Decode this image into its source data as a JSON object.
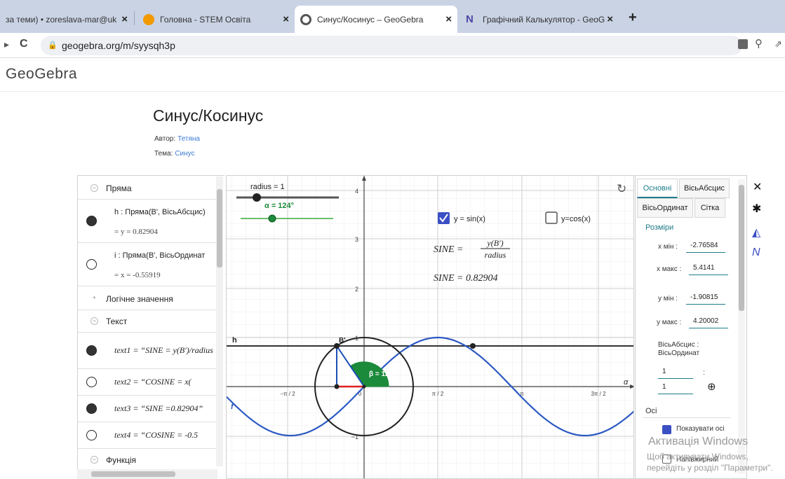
{
  "browser": {
    "tabs": [
      {
        "title": "за теми) • zoreslava-mar@uk",
        "icon_color": "#d93025"
      },
      {
        "title": "Головна - STEM Освіта",
        "icon_color": "#f29900"
      },
      {
        "title": "Синус/Косинус – GeoGebra",
        "icon_color": "#666666"
      },
      {
        "title": "Графічний Калькулятор - GeoG",
        "icon_color": "#5145a8"
      }
    ],
    "close_glyph": "×",
    "new_tab_glyph": "+",
    "url": "geogebra.org/m/syysqh3p",
    "reload_glyph": "C",
    "lock_glyph": "🔒"
  },
  "site": {
    "logo": "GeoGebra"
  },
  "page": {
    "title": "Синус/Косинус",
    "author_label": "Автор:",
    "author": "Тетяна",
    "topic_label": "Тема:",
    "topic": "Синус"
  },
  "algebra": {
    "groups": {
      "line": "Пряма",
      "bool": "Логічне значення",
      "text": "Текст",
      "func": "Функція"
    },
    "h_def": "h : Пряма(B', ВісьАбсцис)",
    "h_val": "= y = 0.82904",
    "i_def": "i : Пряма(B', ВісьОрдинат",
    "i_val": "= x = -0.55919",
    "text1": "text1 = “SINE = y(B')/radius",
    "text2": "text2 = “COSINE = x(",
    "text3": "text3 = “SINE =0.82904”",
    "text4": "text4 = “COSINE = -0.5"
  },
  "graphics": {
    "slider_radius": "radius = 1",
    "slider_alpha": "α = 124°",
    "chk_sin": "y = sin(x)",
    "chk_cos": "y=cos(x)",
    "sine_formula_lhs": "SINE =",
    "sine_formula_num": "y(B')",
    "sine_formula_den": "radius",
    "sine_value": "SINE = 0.82904",
    "point_b": "B'",
    "line_h": "h",
    "angle_label": "β = 124°",
    "axis_x_label": "α",
    "ticks_y": [
      "4",
      "3",
      "2",
      "1"
    ],
    "ticks_x": [
      "−π / 2",
      "0",
      "π / 2",
      "π",
      "3π / 2"
    ],
    "func_label": "f",
    "y_min_label": "−1",
    "colors": {
      "sine": "#2b59c3",
      "angle": "#1b8a3a",
      "red": "#e02020"
    }
  },
  "props": {
    "tab_basic": "Основні",
    "tab_xaxis": "ВісьАбсцис",
    "tab_yaxis": "ВісьОрдинат",
    "tab_grid": "Сітка",
    "sec_dims": "Розміри",
    "xmin_label": "x мін :",
    "xmin": "-2.76584",
    "xmax_label": "x макс :",
    "xmax": "5.4141",
    "ymin_label": "y мін :",
    "ymin": "-1.90815",
    "ymax_label": "y макс :",
    "ymax": "4.20002",
    "ratio_label": "ВісьАбсцис : ВісьОрдинат",
    "ratio_x": "1",
    "ratio_colon": ":",
    "ratio_y": "1",
    "sec_axes": "Осі",
    "show_axes": "Показувати осі",
    "bold": "Напівжирний"
  },
  "watermark": {
    "line1": "Активація Windows",
    "line2": "Щоб активувати Windows, перейдіть у розділ \"Параметри\"."
  }
}
